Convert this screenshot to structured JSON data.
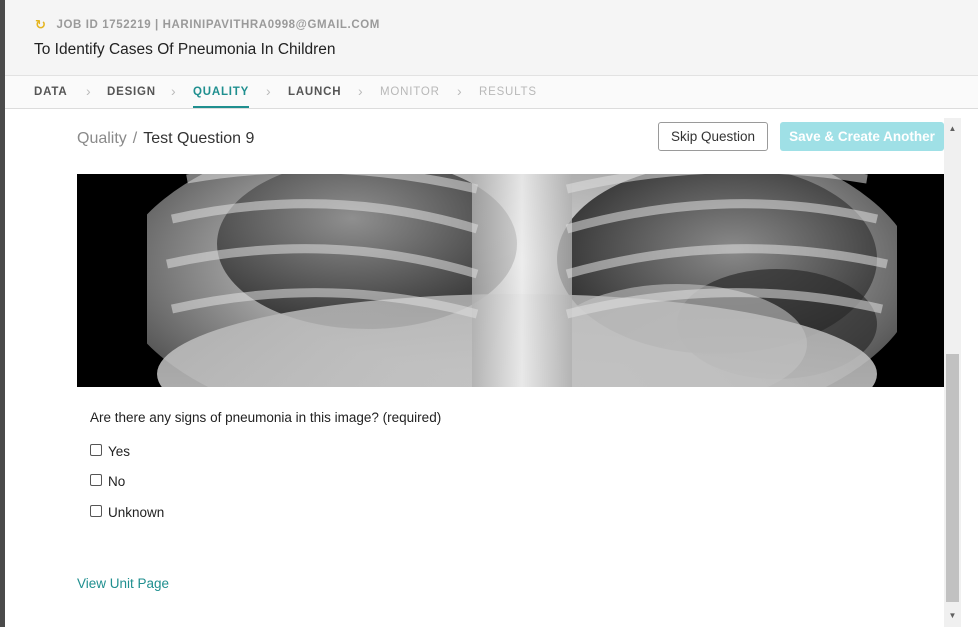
{
  "header": {
    "job_line": "JOB ID 1752219 | HARINIPAVITHRA0998@GMAIL.COM",
    "title": "To Identify Cases Of Pneumonia In Children"
  },
  "tabs": [
    {
      "label": "DATA"
    },
    {
      "label": "DESIGN"
    },
    {
      "label": "QUALITY",
      "active": true
    },
    {
      "label": "LAUNCH"
    },
    {
      "label": "MONITOR"
    },
    {
      "label": "RESULTS"
    }
  ],
  "breadcrumb": {
    "parent": "Quality",
    "separator": "/",
    "current": "Test Question 9"
  },
  "actions": {
    "skip_label": "Skip Question",
    "save_label": "Save & Create Another"
  },
  "question": {
    "text": "Are there any signs of pneumonia in this image? (required)",
    "options": [
      "Yes",
      "No",
      "Unknown"
    ]
  },
  "link_text": "View Unit Page",
  "colors": {
    "accent": "#1f8f8f",
    "save_button": "#9fe0e6",
    "job_icon": "#e5b520"
  },
  "icons": {
    "job_status": "refresh-icon",
    "tab_separator": "chevron-right-icon"
  }
}
